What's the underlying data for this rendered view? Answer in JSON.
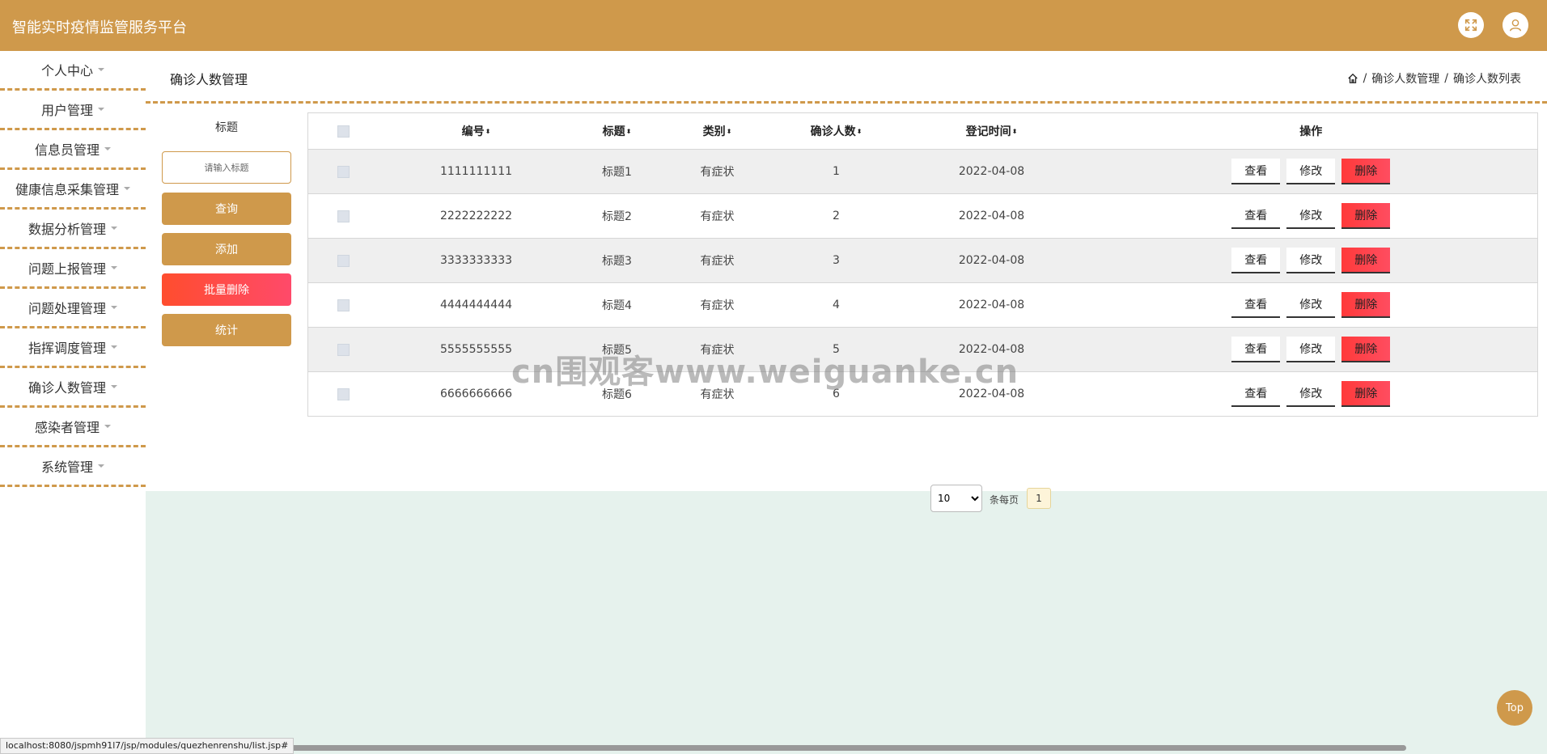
{
  "header": {
    "title": "智能实时疫情监管服务平台",
    "fullscreen_icon": "expand-icon",
    "user_icon": "user-icon"
  },
  "sidebar": {
    "items": [
      {
        "label": "个人中心"
      },
      {
        "label": "用户管理"
      },
      {
        "label": "信息员管理"
      },
      {
        "label": "健康信息采集管理"
      },
      {
        "label": "数据分析管理"
      },
      {
        "label": "问题上报管理"
      },
      {
        "label": "问题处理管理"
      },
      {
        "label": "指挥调度管理"
      },
      {
        "label": "确诊人数管理"
      },
      {
        "label": "感染者管理"
      },
      {
        "label": "系统管理"
      }
    ]
  },
  "page": {
    "title": "确诊人数管理",
    "breadcrumb": [
      "确诊人数管理",
      "确诊人数列表"
    ],
    "separator": "/"
  },
  "search": {
    "label": "标题",
    "placeholder": "请输入标题",
    "query_button": "查询",
    "add_button": "添加",
    "batch_delete_button": "批量删除",
    "stats_button": "统计"
  },
  "table": {
    "headers": {
      "id": "编号",
      "title": "标题",
      "category": "类别",
      "count": "确诊人数",
      "date": "登记时间",
      "ops": "操作"
    },
    "sort_glyph": "⬍",
    "rows": [
      {
        "id": "1111111111",
        "title": "标题1",
        "category": "有症状",
        "count": "1",
        "date": "2022-04-08"
      },
      {
        "id": "2222222222",
        "title": "标题2",
        "category": "有症状",
        "count": "2",
        "date": "2022-04-08"
      },
      {
        "id": "3333333333",
        "title": "标题3",
        "category": "有症状",
        "count": "3",
        "date": "2022-04-08"
      },
      {
        "id": "4444444444",
        "title": "标题4",
        "category": "有症状",
        "count": "4",
        "date": "2022-04-08"
      },
      {
        "id": "5555555555",
        "title": "标题5",
        "category": "有症状",
        "count": "5",
        "date": "2022-04-08"
      },
      {
        "id": "6666666666",
        "title": "标题6",
        "category": "有症状",
        "count": "6",
        "date": "2022-04-08"
      }
    ],
    "actions": {
      "view": "查看",
      "edit": "修改",
      "delete": "删除"
    }
  },
  "pagination": {
    "page_size": "10",
    "per_page_label": "条每页",
    "current_page": "1"
  },
  "status_bar": {
    "url": "localhost:8080/jspmh91l7/jsp/modules/quezhenrenshu/list.jsp#"
  },
  "back_to_top": "Top",
  "watermark": "cn围观客www.weiguanke.cn",
  "colors": {
    "brand": "#cf994b",
    "danger": "#ff4d4d",
    "content_bg": "#e6f2ed"
  }
}
